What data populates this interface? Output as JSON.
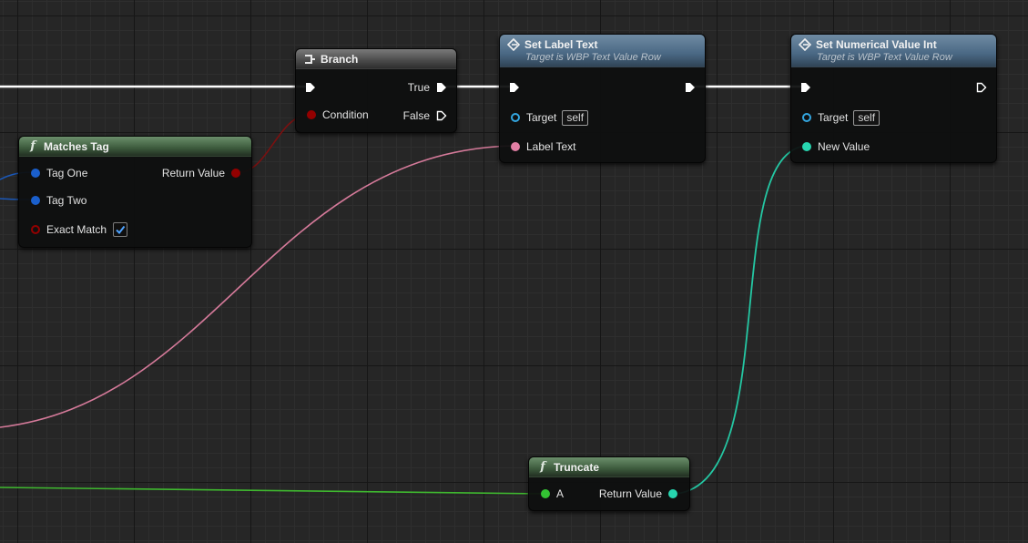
{
  "colors": {
    "exec_wire": "#ffffff",
    "bool_pin": "#930000",
    "bool_wire": "#7a1010",
    "struct_pin": "#1a5fcc",
    "struct_wire": "#1b58b8",
    "text_pin": "#e27fa4",
    "text_wire": "#d57a9a",
    "int_pin": "#27d6b0",
    "int_wire": "#24c7a3",
    "float_pin": "#33c233",
    "float_wire": "#3fb82f",
    "object_pin": "#33a6e0"
  },
  "nodes": {
    "branch": {
      "title": "Branch",
      "icon": "branch-icon",
      "condition_label": "Condition",
      "true_label": "True",
      "false_label": "False"
    },
    "matches_tag": {
      "title": "Matches Tag",
      "icon": "function-icon",
      "icon_glyph": "f",
      "tag_one_label": "Tag One",
      "tag_two_label": "Tag Two",
      "exact_match_label": "Exact Match",
      "exact_match_checked": true,
      "return_label": "Return Value"
    },
    "set_label_text": {
      "title": "Set Label Text",
      "subtitle": "Target is WBP Text Value Row",
      "icon": "set-icon",
      "target_label": "Target",
      "target_value": "self",
      "label_text_label": "Label Text"
    },
    "set_numerical_value_int": {
      "title": "Set Numerical Value Int",
      "subtitle": "Target is WBP Text Value Row",
      "icon": "set-icon",
      "target_label": "Target",
      "target_value": "self",
      "new_value_label": "New Value"
    },
    "truncate": {
      "title": "Truncate",
      "icon": "function-icon",
      "icon_glyph": "f",
      "a_label": "A",
      "return_label": "Return Value"
    }
  }
}
